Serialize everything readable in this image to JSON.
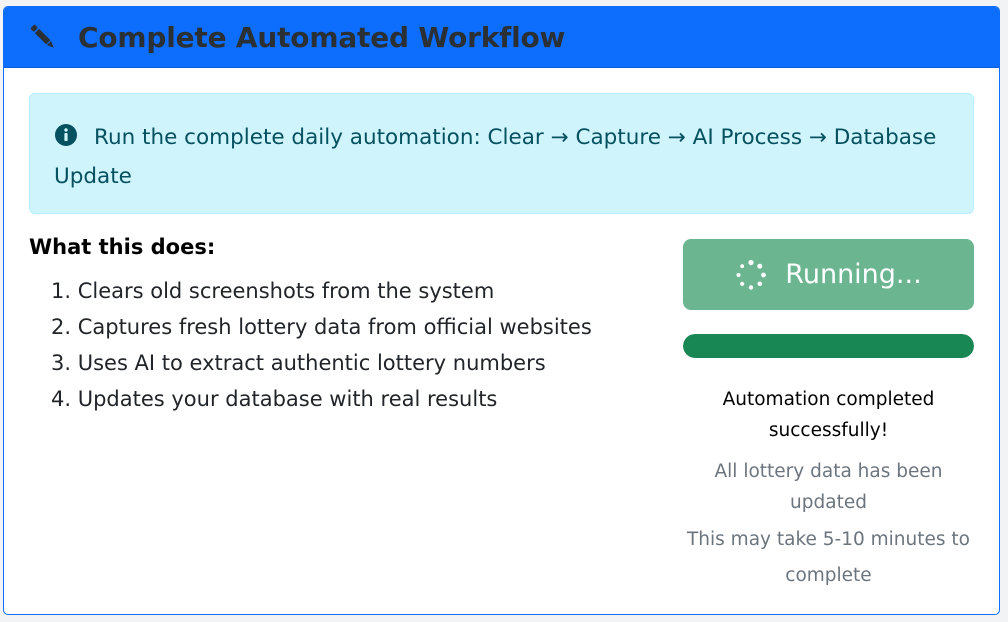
{
  "header": {
    "title": "Complete Automated Workflow",
    "icon": "pencil-icon"
  },
  "alert": {
    "text": "Run the complete daily automation: Clear → Capture → AI Process → Database Update",
    "icon": "info-circle-icon"
  },
  "details": {
    "title": "What this does:",
    "steps": [
      "1. Clears old screenshots from the system",
      "2. Captures fresh lottery data from official websites",
      "3. Uses AI to extract authentic lottery numbers",
      "4. Updates your database with real results"
    ]
  },
  "run_button": {
    "label": "Running...",
    "icon": "spinner-icon"
  },
  "progress": {
    "fraction": 1.0
  },
  "status": {
    "main": "Automation completed successfully!",
    "sub": "All lottery data has been updated",
    "note": "This may take 5-10 minutes to complete"
  },
  "colors": {
    "header_bg": "#0d6efd",
    "alert_bg": "#cff4fc",
    "alert_text": "#055160",
    "button_bg": "#6bb591",
    "progress_fill": "#198754"
  }
}
